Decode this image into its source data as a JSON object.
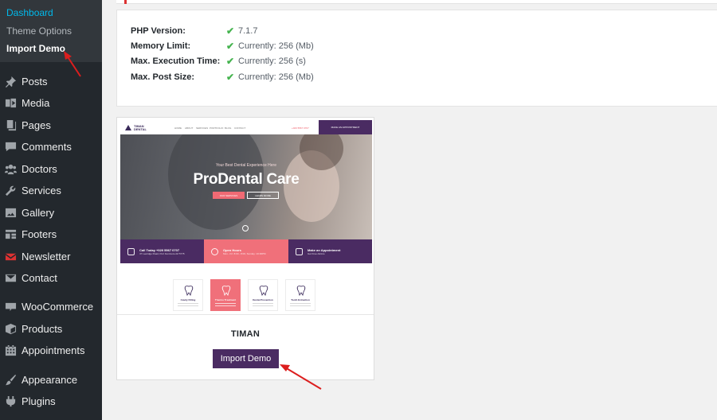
{
  "sidebar": {
    "submenu": [
      {
        "label": "Dashboard",
        "state": "active"
      },
      {
        "label": "Theme Options",
        "state": "normal"
      },
      {
        "label": "Import Demo",
        "state": "current"
      }
    ],
    "items": [
      {
        "label": "Posts",
        "icon": "pushpin-icon"
      },
      {
        "label": "Media",
        "icon": "media-icon"
      },
      {
        "label": "Pages",
        "icon": "pages-icon"
      },
      {
        "label": "Comments",
        "icon": "comment-icon"
      },
      {
        "label": "Doctors",
        "icon": "group-icon"
      },
      {
        "label": "Services",
        "icon": "wrench-icon"
      },
      {
        "label": "Gallery",
        "icon": "gallery-icon"
      },
      {
        "label": "Footers",
        "icon": "layout-icon"
      },
      {
        "label": "Newsletter",
        "icon": "envelope-icon"
      },
      {
        "label": "Contact",
        "icon": "mail-icon"
      },
      {
        "label": "WooCommerce",
        "icon": "woocommerce-icon"
      },
      {
        "label": "Products",
        "icon": "box-icon"
      },
      {
        "label": "Appointments",
        "icon": "calendar-icon"
      },
      {
        "label": "Appearance",
        "icon": "paintbrush-icon"
      },
      {
        "label": "Plugins",
        "icon": "plugin-icon"
      }
    ]
  },
  "system_info": {
    "rows": [
      {
        "label": "PHP Version:",
        "value": "7.1.7"
      },
      {
        "label": "Memory Limit:",
        "value": "Currently: 256 (Mb)"
      },
      {
        "label": "Max. Execution Time:",
        "value": "Currently: 256 (s)"
      },
      {
        "label": "Max. Post Size:",
        "value": "Currently: 256 (Mb)"
      }
    ],
    "check_glyph": "✔"
  },
  "demo": {
    "name": "TIMAN",
    "button_label": "Import Demo",
    "preview": {
      "brand": "TIMAN DENTAL",
      "nav_links": [
        "HOME",
        "ABOUT",
        "SERVICES",
        "PORTFOLIO",
        "BLOG",
        "CONTACT"
      ],
      "phone": "+020 5567 0707",
      "appointment_label": "MAKE AN APPOINTMENT",
      "hero_subtitle": "Your Best Dental Experience Here",
      "hero_title": "ProDental Care",
      "hero_btn_primary": "OUR SERVICES",
      "hero_btn_secondary": "LEARN MORE",
      "info_boxes": [
        {
          "title": "Call Today +020 5567 0707",
          "sub": "47 Leeridge Road, Port Fenimore AZ 5775",
          "color": "#4a2b62"
        },
        {
          "title": "Open Hours",
          "sub": "Mon - Fri: 8:00 - 8:00, Sunday: 10:00PM",
          "color": "#f0707a"
        },
        {
          "title": "Make an Appointment",
          "sub": "Get Free Advice",
          "color": "#4a2b62"
        }
      ],
      "services": [
        "Cavity Filling",
        "Thermo Treatment",
        "Dental Prevention",
        "Tooth Extraction"
      ]
    }
  },
  "colors": {
    "sidebar_bg": "#23282d",
    "accent_blue": "#00b9eb",
    "brand_purple": "#4a2b62",
    "brand_pink": "#f0707a",
    "check_green": "#46b450",
    "annotation_red": "#dc1e1e"
  }
}
